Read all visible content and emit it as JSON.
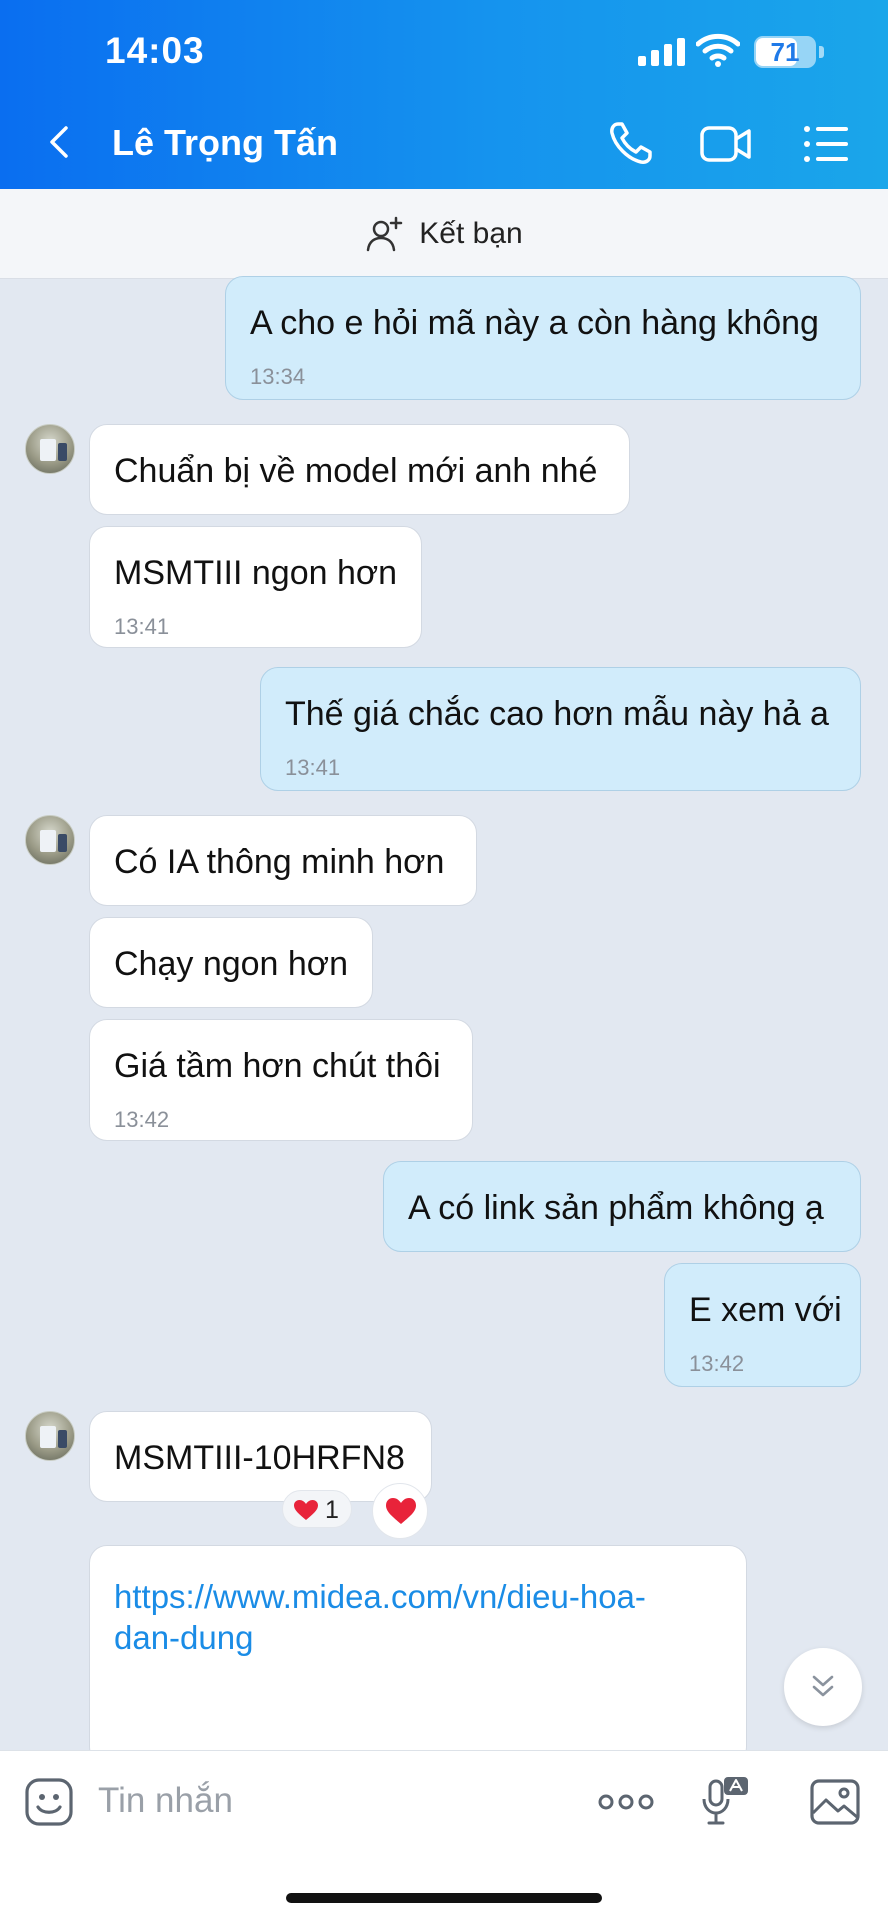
{
  "status_bar": {
    "time": "14:03",
    "battery": "71",
    "battery_level": 0.71
  },
  "header": {
    "title": "Lê Trọng Tấn"
  },
  "friend_bar": {
    "label": "Kết bạn"
  },
  "messages": [
    {
      "dir": "out",
      "text": "A cho e hỏi mã này a còn hàng không",
      "time": "13:34"
    },
    {
      "dir": "in",
      "text": "Chuẩn bị về model mới anh nhé"
    },
    {
      "dir": "in",
      "text": "MSMTIII ngon hơn",
      "time": "13:41"
    },
    {
      "dir": "out",
      "text": "Thế giá chắc cao hơn mẫu này hả a",
      "time": "13:41"
    },
    {
      "dir": "in",
      "text": "Có IA thông minh hơn"
    },
    {
      "dir": "in",
      "text": "Chạy ngon hơn"
    },
    {
      "dir": "in",
      "text": "Giá tầm hơn chút thôi",
      "time": "13:42"
    },
    {
      "dir": "out",
      "text": "A có link sản phẩm không ạ"
    },
    {
      "dir": "out",
      "text": "E xem với",
      "time": "13:42"
    },
    {
      "dir": "in",
      "text": "MSMTIII-10HRFN8",
      "reaction_count": "1"
    },
    {
      "dir": "in",
      "link": "https://www.midea.com/vn/dieu-hoa-dan-dung"
    }
  ],
  "link_lines": [
    "https://www.midea.com/vn/dieu-hoa-",
    "dan-dung"
  ],
  "input": {
    "placeholder": "Tin nhắn"
  },
  "colors": {
    "header_start": "#0a6ef0",
    "header_end": "#1aa6ea",
    "outgoing_bubble": "#d1ecfb",
    "incoming_bubble": "#ffffff",
    "link": "#1a8ce6",
    "heart": "#e8233a"
  }
}
